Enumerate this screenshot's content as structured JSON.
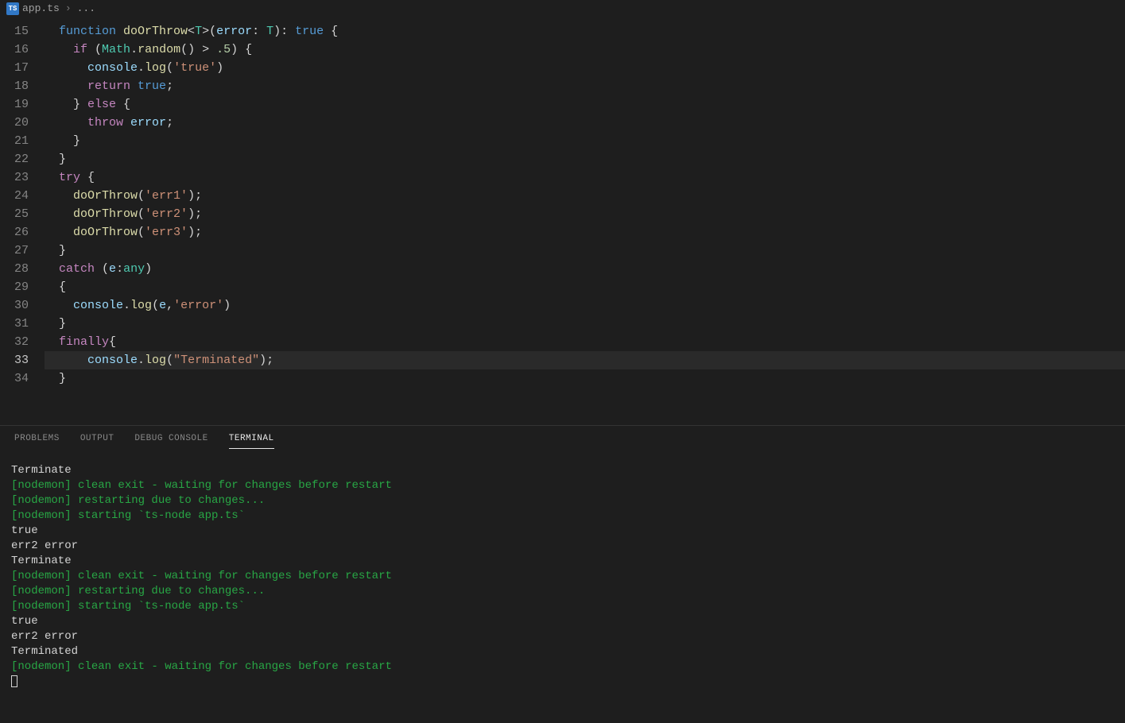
{
  "breadcrumb": {
    "file": "app.ts",
    "tail": "..."
  },
  "editor": {
    "startLine": 15,
    "activeLine": 33,
    "lines": [
      {
        "n": 15,
        "i": 0,
        "t": [
          [
            "kw",
            "function "
          ],
          [
            "fn",
            "doOrThrow"
          ],
          [
            "pu",
            "<"
          ],
          [
            "ty",
            "T"
          ],
          [
            "pu",
            ">("
          ],
          [
            "va",
            "error"
          ],
          [
            "pu",
            ": "
          ],
          [
            "ty",
            "T"
          ],
          [
            "pu",
            "): "
          ],
          [
            "kw",
            "true"
          ],
          [
            "pu",
            " {"
          ]
        ]
      },
      {
        "n": 16,
        "i": 1,
        "t": [
          [
            "kw2",
            "if"
          ],
          [
            "pu",
            " ("
          ],
          [
            "ty",
            "Math"
          ],
          [
            "pu",
            "."
          ],
          [
            "fn",
            "random"
          ],
          [
            "pu",
            "() > "
          ],
          [
            "nu",
            ".5"
          ],
          [
            "pu",
            ") {"
          ]
        ]
      },
      {
        "n": 17,
        "i": 2,
        "t": [
          [
            "va",
            "console"
          ],
          [
            "pu",
            "."
          ],
          [
            "fn",
            "log"
          ],
          [
            "pu",
            "("
          ],
          [
            "st",
            "'true'"
          ],
          [
            "pu",
            ")"
          ]
        ]
      },
      {
        "n": 18,
        "i": 2,
        "t": [
          [
            "kw2",
            "return"
          ],
          [
            "pu",
            " "
          ],
          [
            "kw",
            "true"
          ],
          [
            "pu",
            ";"
          ]
        ]
      },
      {
        "n": 19,
        "i": 1,
        "t": [
          [
            "pu",
            "} "
          ],
          [
            "kw2",
            "else"
          ],
          [
            "pu",
            " {"
          ]
        ]
      },
      {
        "n": 20,
        "i": 2,
        "t": [
          [
            "kw2",
            "throw"
          ],
          [
            "pu",
            " "
          ],
          [
            "va",
            "error"
          ],
          [
            "pu",
            ";"
          ]
        ]
      },
      {
        "n": 21,
        "i": 1,
        "t": [
          [
            "pu",
            "}"
          ]
        ]
      },
      {
        "n": 22,
        "i": 0,
        "t": [
          [
            "pu",
            "}"
          ]
        ]
      },
      {
        "n": 23,
        "i": 0,
        "t": [
          [
            "kw2",
            "try"
          ],
          [
            "pu",
            " {"
          ]
        ]
      },
      {
        "n": 24,
        "i": 1,
        "t": [
          [
            "fn",
            "doOrThrow"
          ],
          [
            "pu",
            "("
          ],
          [
            "st",
            "'err1'"
          ],
          [
            "pu",
            ");"
          ]
        ]
      },
      {
        "n": 25,
        "i": 1,
        "t": [
          [
            "fn",
            "doOrThrow"
          ],
          [
            "pu",
            "("
          ],
          [
            "st",
            "'err2'"
          ],
          [
            "pu",
            ");"
          ]
        ]
      },
      {
        "n": 26,
        "i": 1,
        "t": [
          [
            "fn",
            "doOrThrow"
          ],
          [
            "pu",
            "("
          ],
          [
            "st",
            "'err3'"
          ],
          [
            "pu",
            ");"
          ]
        ]
      },
      {
        "n": 27,
        "i": 0,
        "t": [
          [
            "pu",
            "}"
          ]
        ]
      },
      {
        "n": 28,
        "i": 0,
        "t": [
          [
            "kw2",
            "catch"
          ],
          [
            "pu",
            " ("
          ],
          [
            "va",
            "e"
          ],
          [
            "pu",
            ":"
          ],
          [
            "ty",
            "any"
          ],
          [
            "pu",
            ")"
          ]
        ]
      },
      {
        "n": 29,
        "i": 0,
        "t": [
          [
            "pu",
            "{"
          ]
        ]
      },
      {
        "n": 30,
        "i": 1,
        "t": [
          [
            "va",
            "console"
          ],
          [
            "pu",
            "."
          ],
          [
            "fn",
            "log"
          ],
          [
            "pu",
            "("
          ],
          [
            "va",
            "e"
          ],
          [
            "pu",
            ","
          ],
          [
            "st",
            "'error'"
          ],
          [
            "pu",
            ")"
          ]
        ]
      },
      {
        "n": 31,
        "i": 0,
        "t": [
          [
            "pu",
            "}"
          ]
        ]
      },
      {
        "n": 32,
        "i": 0,
        "t": [
          [
            "kw2",
            "finally"
          ],
          [
            "pu",
            "{"
          ]
        ]
      },
      {
        "n": 33,
        "i": 2,
        "t": [
          [
            "va",
            "console"
          ],
          [
            "pu",
            "."
          ],
          [
            "fn",
            "log"
          ],
          [
            "pu",
            "("
          ],
          [
            "st",
            "\"Terminated\""
          ],
          [
            "pu",
            ");"
          ]
        ]
      },
      {
        "n": 34,
        "i": 0,
        "t": [
          [
            "pu",
            "}"
          ]
        ]
      }
    ]
  },
  "panel": {
    "tabs": [
      {
        "id": "problems",
        "label": "PROBLEMS",
        "active": false
      },
      {
        "id": "output",
        "label": "OUTPUT",
        "active": false
      },
      {
        "id": "debug",
        "label": "DEBUG CONSOLE",
        "active": false
      },
      {
        "id": "terminal",
        "label": "TERMINAL",
        "active": true
      }
    ],
    "terminal": [
      {
        "cls": "t-white",
        "text": "Terminate"
      },
      {
        "cls": "t-green",
        "text": "[nodemon] clean exit - waiting for changes before restart"
      },
      {
        "cls": "t-green",
        "text": "[nodemon] restarting due to changes..."
      },
      {
        "cls": "t-green",
        "text": "[nodemon] starting `ts-node app.ts`"
      },
      {
        "cls": "t-white",
        "text": "true"
      },
      {
        "cls": "t-white",
        "text": "err2 error"
      },
      {
        "cls": "t-white",
        "text": "Terminate"
      },
      {
        "cls": "t-green",
        "text": "[nodemon] clean exit - waiting for changes before restart"
      },
      {
        "cls": "t-green",
        "text": "[nodemon] restarting due to changes..."
      },
      {
        "cls": "t-green",
        "text": "[nodemon] starting `ts-node app.ts`"
      },
      {
        "cls": "t-white",
        "text": "true"
      },
      {
        "cls": "t-white",
        "text": "err2 error"
      },
      {
        "cls": "t-white",
        "text": "Terminated"
      },
      {
        "cls": "t-green",
        "text": "[nodemon] clean exit - waiting for changes before restart"
      }
    ]
  }
}
